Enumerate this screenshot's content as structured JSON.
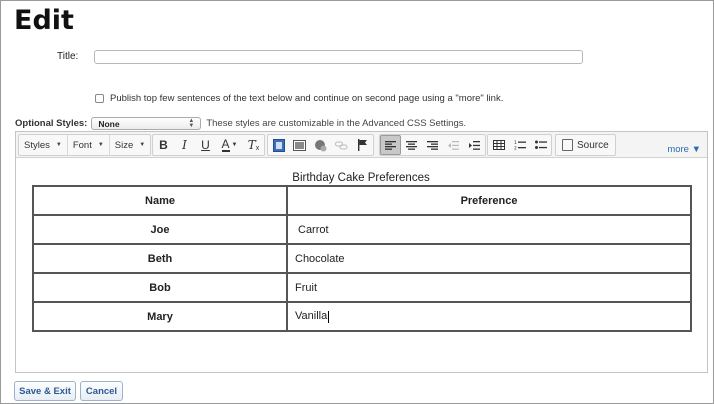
{
  "page": {
    "title": "Edit"
  },
  "title_field": {
    "label": "Title:",
    "value": ""
  },
  "publish": {
    "label": "Publish top few sentences of the text below and continue on second page using a \"more\" link."
  },
  "optional_styles": {
    "label": "Optional Styles:",
    "selected": "None",
    "note": "These styles are customizable in the Advanced CSS Settings."
  },
  "toolbar": {
    "styles": "Styles",
    "font": "Font",
    "size": "Size",
    "source": "Source",
    "more": "more ▼",
    "icons": [
      "bold-icon",
      "italic-icon",
      "underline-icon",
      "text-color-icon",
      "remove-format-icon",
      "film-icon",
      "image-icon",
      "media-icon",
      "link-icon",
      "flag-icon",
      "align-left-icon",
      "align-center-icon",
      "align-right-icon",
      "outdent-icon",
      "indent-icon",
      "table-icon",
      "numbered-list-icon",
      "bulleted-list-icon",
      "source-icon"
    ]
  },
  "table": {
    "caption": "Birthday Cake Preferences",
    "headers": [
      "Name",
      "Preference"
    ],
    "rows": [
      {
        "name": "Joe",
        "preference": "Carrot"
      },
      {
        "name": "Beth",
        "preference": "Chocolate"
      },
      {
        "name": "Bob",
        "preference": "Fruit"
      },
      {
        "name": "Mary",
        "preference": "Vanilla"
      }
    ]
  },
  "buttons": {
    "save": "Save & Exit",
    "cancel": "Cancel"
  }
}
